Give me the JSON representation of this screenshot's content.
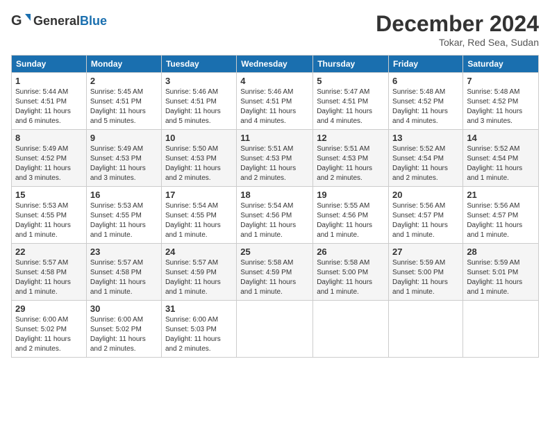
{
  "logo": {
    "general": "General",
    "blue": "Blue"
  },
  "title": "December 2024",
  "location": "Tokar, Red Sea, Sudan",
  "days_of_week": [
    "Sunday",
    "Monday",
    "Tuesday",
    "Wednesday",
    "Thursday",
    "Friday",
    "Saturday"
  ],
  "weeks": [
    [
      {
        "day": "1",
        "sunrise": "5:44 AM",
        "sunset": "4:51 PM",
        "daylight": "11 hours and 6 minutes."
      },
      {
        "day": "2",
        "sunrise": "5:45 AM",
        "sunset": "4:51 PM",
        "daylight": "11 hours and 5 minutes."
      },
      {
        "day": "3",
        "sunrise": "5:46 AM",
        "sunset": "4:51 PM",
        "daylight": "11 hours and 5 minutes."
      },
      {
        "day": "4",
        "sunrise": "5:46 AM",
        "sunset": "4:51 PM",
        "daylight": "11 hours and 4 minutes."
      },
      {
        "day": "5",
        "sunrise": "5:47 AM",
        "sunset": "4:51 PM",
        "daylight": "11 hours and 4 minutes."
      },
      {
        "day": "6",
        "sunrise": "5:48 AM",
        "sunset": "4:52 PM",
        "daylight": "11 hours and 4 minutes."
      },
      {
        "day": "7",
        "sunrise": "5:48 AM",
        "sunset": "4:52 PM",
        "daylight": "11 hours and 3 minutes."
      }
    ],
    [
      {
        "day": "8",
        "sunrise": "5:49 AM",
        "sunset": "4:52 PM",
        "daylight": "11 hours and 3 minutes."
      },
      {
        "day": "9",
        "sunrise": "5:49 AM",
        "sunset": "4:53 PM",
        "daylight": "11 hours and 3 minutes."
      },
      {
        "day": "10",
        "sunrise": "5:50 AM",
        "sunset": "4:53 PM",
        "daylight": "11 hours and 2 minutes."
      },
      {
        "day": "11",
        "sunrise": "5:51 AM",
        "sunset": "4:53 PM",
        "daylight": "11 hours and 2 minutes."
      },
      {
        "day": "12",
        "sunrise": "5:51 AM",
        "sunset": "4:53 PM",
        "daylight": "11 hours and 2 minutes."
      },
      {
        "day": "13",
        "sunrise": "5:52 AM",
        "sunset": "4:54 PM",
        "daylight": "11 hours and 2 minutes."
      },
      {
        "day": "14",
        "sunrise": "5:52 AM",
        "sunset": "4:54 PM",
        "daylight": "11 hours and 1 minute."
      }
    ],
    [
      {
        "day": "15",
        "sunrise": "5:53 AM",
        "sunset": "4:55 PM",
        "daylight": "11 hours and 1 minute."
      },
      {
        "day": "16",
        "sunrise": "5:53 AM",
        "sunset": "4:55 PM",
        "daylight": "11 hours and 1 minute."
      },
      {
        "day": "17",
        "sunrise": "5:54 AM",
        "sunset": "4:55 PM",
        "daylight": "11 hours and 1 minute."
      },
      {
        "day": "18",
        "sunrise": "5:54 AM",
        "sunset": "4:56 PM",
        "daylight": "11 hours and 1 minute."
      },
      {
        "day": "19",
        "sunrise": "5:55 AM",
        "sunset": "4:56 PM",
        "daylight": "11 hours and 1 minute."
      },
      {
        "day": "20",
        "sunrise": "5:56 AM",
        "sunset": "4:57 PM",
        "daylight": "11 hours and 1 minute."
      },
      {
        "day": "21",
        "sunrise": "5:56 AM",
        "sunset": "4:57 PM",
        "daylight": "11 hours and 1 minute."
      }
    ],
    [
      {
        "day": "22",
        "sunrise": "5:57 AM",
        "sunset": "4:58 PM",
        "daylight": "11 hours and 1 minute."
      },
      {
        "day": "23",
        "sunrise": "5:57 AM",
        "sunset": "4:58 PM",
        "daylight": "11 hours and 1 minute."
      },
      {
        "day": "24",
        "sunrise": "5:57 AM",
        "sunset": "4:59 PM",
        "daylight": "11 hours and 1 minute."
      },
      {
        "day": "25",
        "sunrise": "5:58 AM",
        "sunset": "4:59 PM",
        "daylight": "11 hours and 1 minute."
      },
      {
        "day": "26",
        "sunrise": "5:58 AM",
        "sunset": "5:00 PM",
        "daylight": "11 hours and 1 minute."
      },
      {
        "day": "27",
        "sunrise": "5:59 AM",
        "sunset": "5:00 PM",
        "daylight": "11 hours and 1 minute."
      },
      {
        "day": "28",
        "sunrise": "5:59 AM",
        "sunset": "5:01 PM",
        "daylight": "11 hours and 1 minute."
      }
    ],
    [
      {
        "day": "29",
        "sunrise": "6:00 AM",
        "sunset": "5:02 PM",
        "daylight": "11 hours and 2 minutes."
      },
      {
        "day": "30",
        "sunrise": "6:00 AM",
        "sunset": "5:02 PM",
        "daylight": "11 hours and 2 minutes."
      },
      {
        "day": "31",
        "sunrise": "6:00 AM",
        "sunset": "5:03 PM",
        "daylight": "11 hours and 2 minutes."
      },
      null,
      null,
      null,
      null
    ]
  ]
}
